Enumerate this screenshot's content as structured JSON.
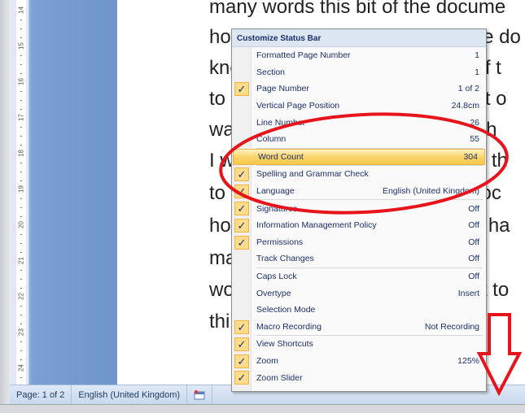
{
  "document": {
    "lines": [
      "many words this bit of the docume",
      "how many words I thinking of the do",
      "know how many words this bit of t",
      "to know how many words this bit o",
      "want to know how many words th",
      "I want to know how many words th",
      "to know how many words this doc",
      "how many words this document ha",
      "many words this one has. I w",
      "words and I want to know I want to",
      "think this bit I know"
    ],
    "ruler_numbers": [
      "14",
      "15",
      "16",
      "17",
      "18",
      "19",
      "20",
      "21",
      "22",
      "23",
      "24"
    ]
  },
  "menu": {
    "title": "Customize Status Bar",
    "items": [
      {
        "label": "Formatted Page Number",
        "value": "1",
        "checked": false
      },
      {
        "label": "Section",
        "value": "1",
        "checked": false
      },
      {
        "label": "Page Number",
        "value": "1 of 2",
        "checked": true
      },
      {
        "label": "Vertical Page Position",
        "value": "24.8cm",
        "checked": false
      },
      {
        "label": "Line Number",
        "value": "26",
        "checked": false
      },
      {
        "label": "Column",
        "value": "55",
        "checked": false,
        "sep_after": true
      },
      {
        "label": "Word Count",
        "value": "304",
        "checked": false,
        "highlighted": true,
        "sep_after": true
      },
      {
        "label": "Spelling and Grammar Check",
        "value": "",
        "checked": true
      },
      {
        "label": "Language",
        "value": "English (United Kingdom)",
        "checked": true,
        "sep_after": true
      },
      {
        "label": "Signatures",
        "value": "Off",
        "checked": true
      },
      {
        "label": "Information Management Policy",
        "value": "Off",
        "checked": true
      },
      {
        "label": "Permissions",
        "value": "Off",
        "checked": true
      },
      {
        "label": "Track Changes",
        "value": "Off",
        "checked": false,
        "sep_after": true
      },
      {
        "label": "Caps Lock",
        "value": "Off",
        "checked": false
      },
      {
        "label": "Overtype",
        "value": "Insert",
        "checked": false
      },
      {
        "label": "Selection Mode",
        "value": "",
        "checked": false
      },
      {
        "label": "Macro Recording",
        "value": "Not Recording",
        "checked": true,
        "sep_after": true
      },
      {
        "label": "View Shortcuts",
        "value": "",
        "checked": true
      },
      {
        "label": "Zoom",
        "value": "125%",
        "checked": true
      },
      {
        "label": "Zoom Slider",
        "value": "",
        "checked": true
      }
    ],
    "check_glyph": "✓"
  },
  "statusbar": {
    "page": "Page: 1 of 2",
    "language": "English (United Kingdom)",
    "macro_icon": "macro-record-icon"
  },
  "colors": {
    "annotation": "#e8141c",
    "highlight": "#fbd56c"
  }
}
